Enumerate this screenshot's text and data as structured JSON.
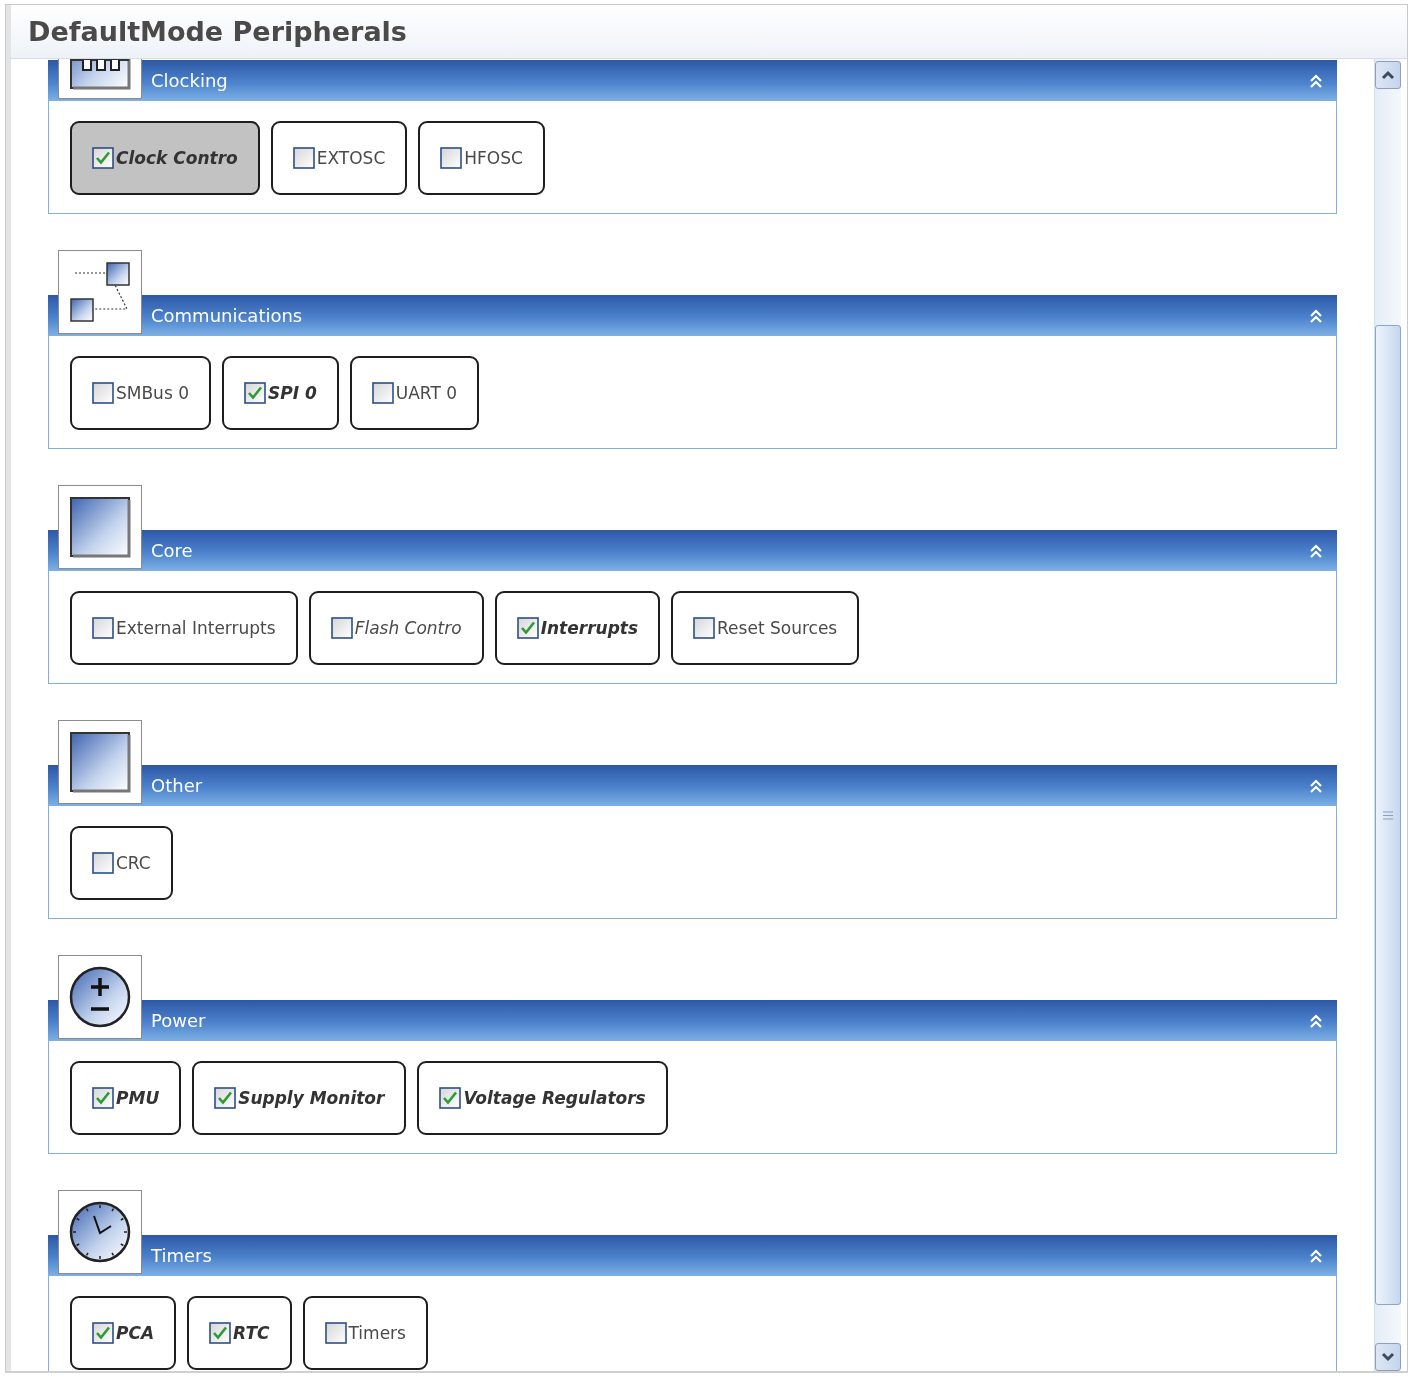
{
  "window": {
    "title": "DefaultMode Peripherals"
  },
  "sections": [
    {
      "title": "Clocking",
      "expanded": true,
      "items": [
        {
          "label": "Clock Contro",
          "checked": true,
          "selected": true,
          "kind": "emphasized"
        },
        {
          "label": "EXTOSC",
          "checked": false,
          "selected": false,
          "kind": "plain"
        },
        {
          "label": "HFOSC",
          "checked": false,
          "selected": false,
          "kind": "plain"
        }
      ]
    },
    {
      "title": "Communications",
      "expanded": true,
      "items": [
        {
          "label": "SMBus 0",
          "checked": false,
          "selected": false,
          "kind": "plain"
        },
        {
          "label": "SPI 0",
          "checked": true,
          "selected": false,
          "kind": "emphasized"
        },
        {
          "label": "UART 0",
          "checked": false,
          "selected": false,
          "kind": "plain"
        }
      ]
    },
    {
      "title": "Core",
      "expanded": true,
      "items": [
        {
          "label": "External Interrupts",
          "checked": false,
          "selected": false,
          "kind": "plain"
        },
        {
          "label": "Flash Contro",
          "checked": false,
          "selected": false,
          "kind": "italic"
        },
        {
          "label": "Interrupts",
          "checked": true,
          "selected": false,
          "kind": "emphasized"
        },
        {
          "label": "Reset Sources",
          "checked": false,
          "selected": false,
          "kind": "plain"
        }
      ]
    },
    {
      "title": "Other",
      "expanded": true,
      "items": [
        {
          "label": "CRC",
          "checked": false,
          "selected": false,
          "kind": "plain"
        }
      ]
    },
    {
      "title": "Power",
      "expanded": true,
      "items": [
        {
          "label": "PMU",
          "checked": true,
          "selected": false,
          "kind": "emphasized"
        },
        {
          "label": "Supply Monitor",
          "checked": true,
          "selected": false,
          "kind": "emphasized"
        },
        {
          "label": "Voltage Regulators",
          "checked": true,
          "selected": false,
          "kind": "emphasized"
        }
      ]
    },
    {
      "title": "Timers",
      "expanded": true,
      "items": [
        {
          "label": "PCA",
          "checked": true,
          "selected": false,
          "kind": "emphasized"
        },
        {
          "label": "RTC",
          "checked": true,
          "selected": false,
          "kind": "emphasized"
        },
        {
          "label": "Timers",
          "checked": false,
          "selected": false,
          "kind": "plain"
        }
      ]
    }
  ]
}
